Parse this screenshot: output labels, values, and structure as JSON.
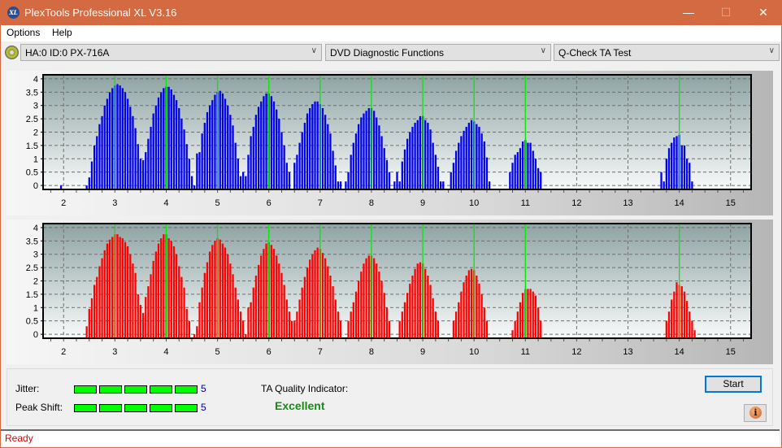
{
  "window": {
    "title": "PlexTools Professional XL V3.16",
    "icon_label": "XL",
    "minimize": "—",
    "maximize": "☐",
    "close": "✕"
  },
  "menu": {
    "items": [
      "Options",
      "Help"
    ]
  },
  "toolbar": {
    "drive": "HA:0 ID:0  PX-716A",
    "function": "DVD Diagnostic Functions",
    "test": "Q-Check TA Test",
    "chevron": "∨"
  },
  "colors": {
    "upper_bars": "#0000ee",
    "lower_bars": "#ff0000",
    "marker_lines": "#00ee00",
    "status": "#e00000",
    "quality": "#188a18"
  },
  "chart_data": [
    {
      "type": "bar",
      "name": "upper-land-chart",
      "xlim": [
        1.6,
        15.4
      ],
      "ylim": [
        -0.15,
        4.15
      ],
      "xticks": [
        2,
        3,
        4,
        5,
        6,
        7,
        8,
        9,
        10,
        11,
        12,
        13,
        14,
        15
      ],
      "yticks": [
        0,
        0.5,
        1,
        1.5,
        2,
        2.5,
        3,
        3.5,
        4
      ],
      "ytick_labels": [
        "0",
        "0.5",
        "1",
        "1.5",
        "2",
        "2.5",
        "3",
        "3.5",
        "4"
      ],
      "grid": true,
      "markers": [
        3,
        4,
        5,
        6,
        7,
        8,
        9,
        10,
        11,
        14
      ],
      "bar_step": 0.05,
      "peaks": [
        {
          "start": 1.95,
          "values": [
            0.0
          ]
        },
        {
          "start": 2.45,
          "values": [
            0.0,
            0.3,
            0.9,
            1.5,
            1.85,
            2.3,
            2.6,
            3.0,
            3.25,
            3.5,
            3.65,
            3.75,
            3.8,
            3.75,
            3.65,
            3.5,
            3.25,
            2.95,
            2.6,
            2.15,
            1.55,
            1.0,
            0.5,
            0.0
          ]
        },
        {
          "start": 3.5,
          "values": [
            0.85,
            0.95,
            1.25,
            1.75,
            2.2,
            2.7,
            3.0,
            3.3,
            3.5,
            3.65,
            3.7,
            3.7,
            3.6,
            3.4,
            3.2,
            2.9,
            2.5,
            2.1,
            1.55,
            1.0,
            0.35
          ]
        },
        {
          "start": 4.55,
          "values": [
            0.0,
            1.2,
            1.25,
            1.95,
            2.35,
            2.75,
            3.0,
            3.2,
            3.4,
            3.5,
            3.55,
            3.45,
            3.25,
            3.0,
            2.65,
            2.25,
            1.6,
            1.0,
            0.35
          ]
        },
        {
          "start": 5.5,
          "values": [
            0.5,
            0.35,
            1.15,
            1.85,
            2.2,
            2.65,
            2.95,
            3.15,
            3.35,
            3.45,
            3.45,
            3.35,
            3.15,
            2.85,
            2.5,
            2.0,
            1.5,
            0.85,
            0.5
          ]
        },
        {
          "start": 6.5,
          "values": [
            0.85,
            1.15,
            1.6,
            2.0,
            2.35,
            2.7,
            2.9,
            3.05,
            3.15,
            3.15,
            3.05,
            2.9,
            2.65,
            2.3,
            1.95,
            1.3,
            0.75,
            0.15,
            0.15
          ]
        },
        {
          "start": 7.5,
          "values": [
            0.15,
            0.5,
            1.15,
            1.6,
            1.95,
            2.3,
            2.55,
            2.7,
            2.8,
            2.9,
            2.9,
            2.8,
            2.55,
            2.25,
            1.85,
            1.4,
            0.95,
            0.5
          ]
        },
        {
          "start": 8.45,
          "values": [
            0.15,
            0.5,
            0.15,
            0.9,
            1.35,
            1.75,
            2.0,
            2.2,
            2.35,
            2.45,
            2.6,
            2.6,
            2.45,
            2.35,
            2.1,
            1.6,
            1.15,
            0.7,
            0.15,
            0.15
          ]
        },
        {
          "start": 9.55,
          "values": [
            0.5,
            0.85,
            1.3,
            1.6,
            1.85,
            2.05,
            2.2,
            2.35,
            2.45,
            2.4,
            2.3,
            2.2,
            1.95,
            1.65,
            1.05,
            0.15
          ]
        },
        {
          "start": 10.7,
          "values": [
            0.5,
            0.85,
            1.15,
            1.25,
            1.4,
            1.65,
            1.7,
            1.6,
            1.6,
            1.3,
            1.0,
            0.65,
            0.5
          ]
        },
        {
          "start": 13.65,
          "values": [
            0.5,
            0.15,
            1.0,
            1.4,
            1.6,
            1.8,
            1.85,
            1.9,
            1.5,
            1.5,
            1.0,
            0.85,
            0.15
          ]
        }
      ]
    },
    {
      "type": "bar",
      "name": "lower-pit-chart",
      "xlim": [
        1.6,
        15.4
      ],
      "ylim": [
        -0.15,
        4.15
      ],
      "xticks": [
        2,
        3,
        4,
        5,
        6,
        7,
        8,
        9,
        10,
        11,
        12,
        13,
        14,
        15
      ],
      "yticks": [
        0,
        0.5,
        1,
        1.5,
        2,
        2.5,
        3,
        3.5,
        4
      ],
      "ytick_labels": [
        "0",
        "0.5",
        "1",
        "1.5",
        "2",
        "2.5",
        "3",
        "3.5",
        "4"
      ],
      "grid": true,
      "markers": [
        3,
        4,
        5,
        6,
        7,
        8,
        9,
        10,
        11,
        14
      ],
      "bar_step": 0.05,
      "peaks": [
        {
          "start": 2.45,
          "values": [
            0.3,
            0.95,
            1.35,
            1.85,
            2.15,
            2.55,
            2.85,
            3.15,
            3.4,
            3.55,
            3.65,
            3.75,
            3.75,
            3.65,
            3.6,
            3.45,
            3.3,
            3.0,
            2.65,
            2.3,
            1.5,
            1.1,
            0.6
          ]
        },
        {
          "start": 3.55,
          "values": [
            0.8,
            1.4,
            1.8,
            2.25,
            2.75,
            3.1,
            3.4,
            3.6,
            3.75,
            3.75,
            3.6,
            3.5,
            3.3,
            3.0,
            2.55,
            2.15,
            1.75,
            0.95,
            0.5
          ]
        },
        {
          "start": 4.55,
          "values": [
            0.0,
            0.3,
            1.2,
            1.75,
            2.3,
            2.7,
            3.1,
            3.35,
            3.5,
            3.6,
            3.55,
            3.4,
            3.25,
            3.0,
            2.65,
            2.25,
            1.75,
            1.3,
            0.85,
            0.5
          ]
        },
        {
          "start": 5.55,
          "values": [
            0.0,
            1.0,
            1.2,
            1.75,
            2.2,
            2.6,
            2.95,
            3.2,
            3.4,
            3.45,
            3.35,
            3.2,
            2.95,
            2.65,
            2.3,
            1.85,
            1.3,
            0.85,
            0.5
          ]
        },
        {
          "start": 6.5,
          "values": [
            0.5,
            0.85,
            1.3,
            1.75,
            2.15,
            2.5,
            2.8,
            3.0,
            3.15,
            3.25,
            3.2,
            3.05,
            2.85,
            2.55,
            2.2,
            1.8,
            1.3,
            0.85,
            0.5
          ]
        },
        {
          "start": 7.55,
          "values": [
            0.5,
            0.85,
            1.2,
            1.6,
            2.0,
            2.35,
            2.65,
            2.85,
            2.95,
            2.95,
            2.85,
            2.65,
            2.35,
            2.0,
            1.55,
            1.0,
            0.5
          ]
        },
        {
          "start": 8.55,
          "values": [
            0.5,
            0.85,
            1.2,
            1.55,
            1.9,
            2.2,
            2.45,
            2.65,
            2.7,
            2.65,
            2.45,
            2.2,
            1.85,
            1.35,
            0.85,
            0.5
          ]
        },
        {
          "start": 9.6,
          "values": [
            0.5,
            0.85,
            1.2,
            1.6,
            1.95,
            2.2,
            2.4,
            2.45,
            2.4,
            2.2,
            1.9,
            1.5,
            1.0,
            0.5
          ]
        },
        {
          "start": 10.75,
          "values": [
            0.15,
            0.5,
            0.85,
            1.2,
            1.55,
            1.7,
            1.7,
            1.7,
            1.6,
            1.45,
            1.0,
            0.5
          ]
        },
        {
          "start": 13.75,
          "values": [
            0.5,
            0.85,
            1.3,
            1.6,
            1.95,
            1.85,
            1.8,
            1.6,
            1.25,
            0.85,
            0.5,
            0.15
          ]
        }
      ]
    }
  ],
  "results": {
    "jitter_label": "Jitter:",
    "jitter_value": "5",
    "jitter_level": 5,
    "peak_shift_label": "Peak Shift:",
    "peak_shift_value": "5",
    "peak_shift_level": 5,
    "meter_max": 5,
    "ta_label": "TA Quality Indicator:",
    "ta_value": "Excellent"
  },
  "buttons": {
    "start": "Start",
    "info": "i"
  },
  "status": "Ready"
}
